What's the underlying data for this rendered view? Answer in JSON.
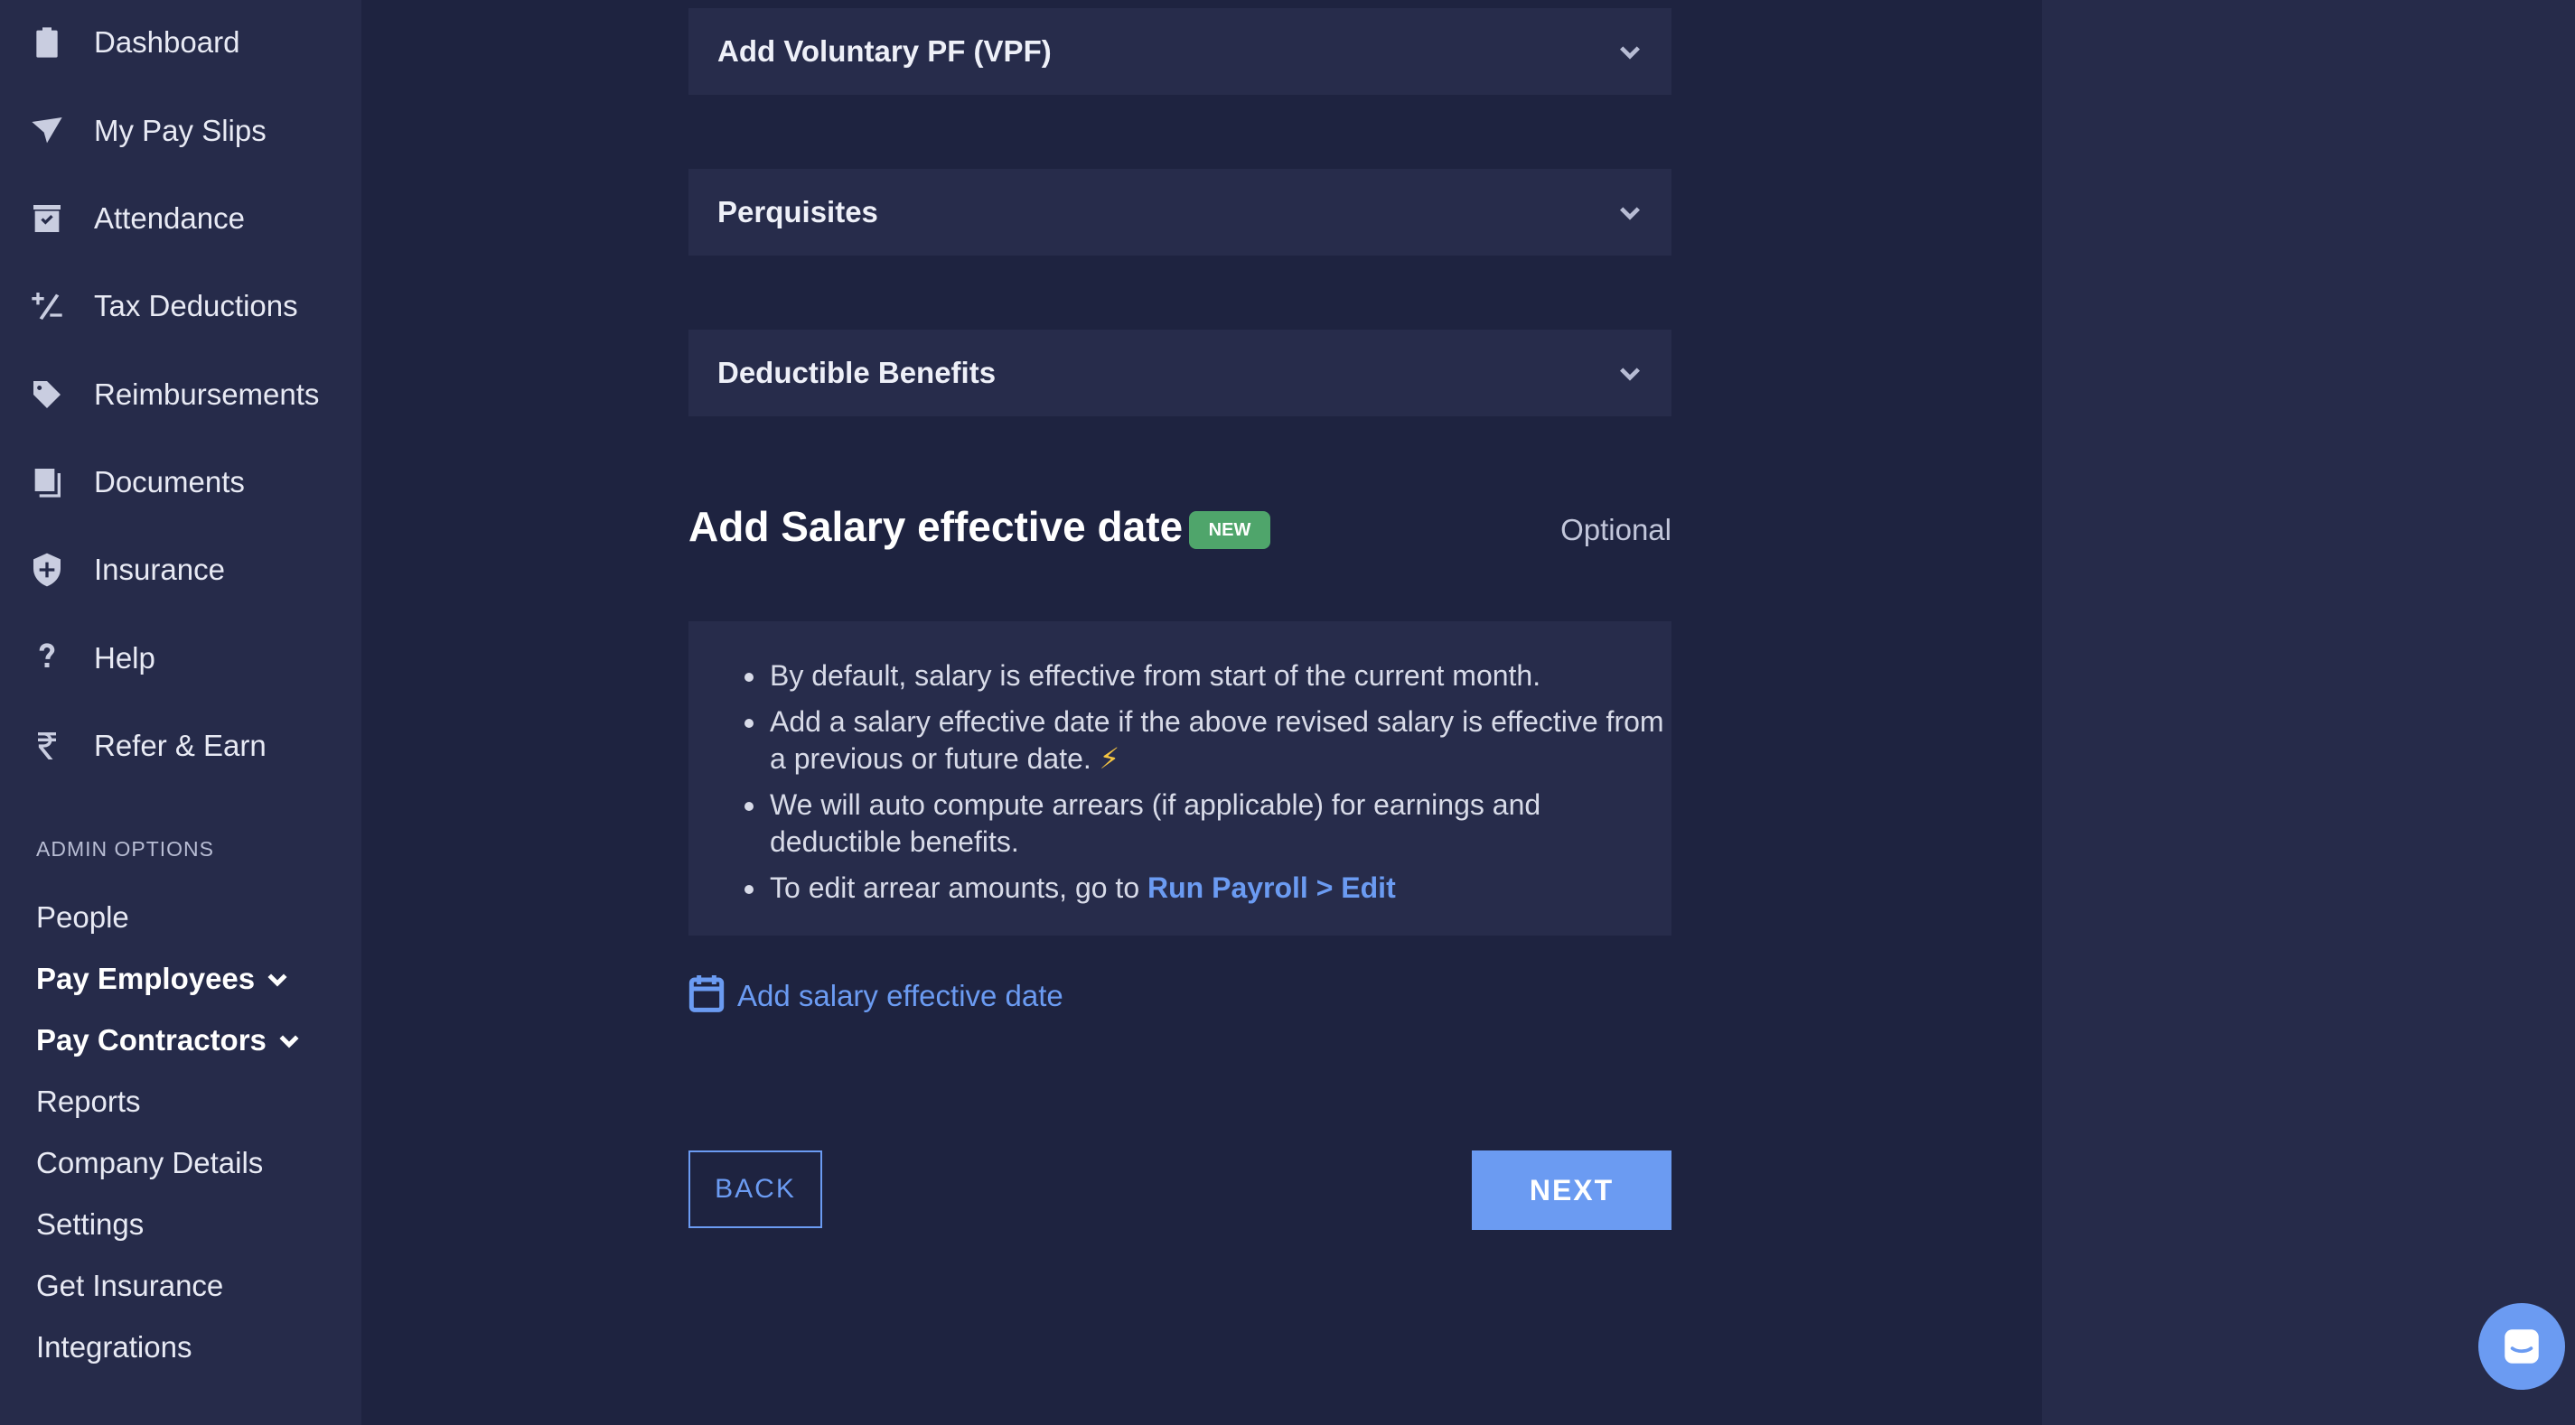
{
  "sidebar": {
    "nav": [
      {
        "label": "Dashboard",
        "icon": "clipboard-icon"
      },
      {
        "label": "My Pay Slips",
        "icon": "paper-plane-icon"
      },
      {
        "label": "Attendance",
        "icon": "calendar-check-icon"
      },
      {
        "label": "Tax Deductions",
        "icon": "plus-minus-icon"
      },
      {
        "label": "Reimbursements",
        "icon": "tag-icon"
      },
      {
        "label": "Documents",
        "icon": "documents-icon"
      },
      {
        "label": "Insurance",
        "icon": "shield-plus-icon"
      },
      {
        "label": "Help",
        "icon": "question-icon"
      },
      {
        "label": "Refer & Earn",
        "icon": "rupee-icon"
      }
    ],
    "admin_heading": "ADMIN OPTIONS",
    "admin": [
      {
        "label": "People"
      },
      {
        "label": "Pay Employees"
      },
      {
        "label": "Pay Contractors"
      },
      {
        "label": "Reports"
      },
      {
        "label": "Company Details"
      },
      {
        "label": "Settings"
      },
      {
        "label": "Get Insurance"
      },
      {
        "label": "Integrations"
      }
    ]
  },
  "main": {
    "accordions": [
      {
        "title": "Add Voluntary PF (VPF)"
      },
      {
        "title": "Perquisites"
      },
      {
        "title": "Deductible Benefits"
      }
    ],
    "section_title": "Add Salary effective date",
    "badge": "NEW",
    "optional_label": "Optional",
    "info": {
      "b1": "By default, salary is effective from start of the current month.",
      "b2": "Add a salary effective date if the above revised salary is effective from a previous or future date.",
      "b2_emoji": "⚡",
      "b3": "We will auto compute arrears (if applicable) for earnings and deductible benefits.",
      "b4_prefix": "To edit arrear amounts, go to ",
      "b4_link": "Run Payroll > Edit"
    },
    "add_date_label": "Add salary effective date",
    "back_label": "BACK",
    "next_label": "NEXT"
  },
  "colors": {
    "background": "#1e2340",
    "sidebar": "#262b4a",
    "accent": "#6b9bf2",
    "badge": "#4fa56b"
  }
}
